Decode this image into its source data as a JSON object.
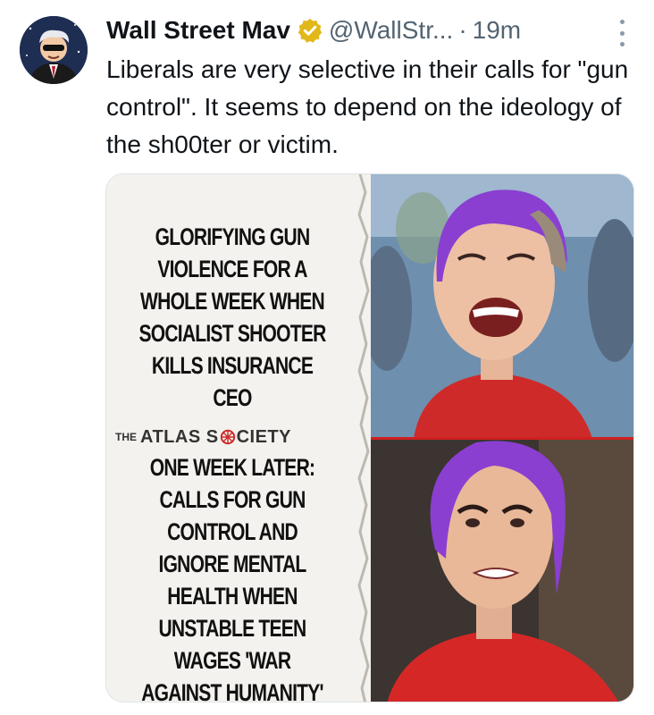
{
  "tweet": {
    "author": {
      "display_name": "Wall Street Mav",
      "handle": "@WallStr...",
      "verified": true,
      "verified_color": "#e2b719"
    },
    "separator": "·",
    "timestamp": "19m",
    "more_icon": "more-vertical-icon",
    "text": "Liberals are very selective in their calls for \"gun control\". It seems to depend on the ideology of the sh00ter or victim."
  },
  "media": {
    "headline_top": "GLORIFYING GUN VIOLENCE FOR A WHOLE WEEK WHEN SOCIALIST SHOOTER KILLS INSURANCE CEO",
    "brand_prefix": "THE",
    "brand_name_1": "ATLAS S",
    "brand_name_2": "CIETY",
    "headline_bottom": "ONE WEEK LATER: CALLS FOR GUN CONTROL AND IGNORE MENTAL HEALTH WHEN UNSTABLE TEEN WAGES 'WAR AGAINST HUMANITY'",
    "accent_color": "#cf2a2a",
    "hair_color": "#8a3fd1"
  }
}
